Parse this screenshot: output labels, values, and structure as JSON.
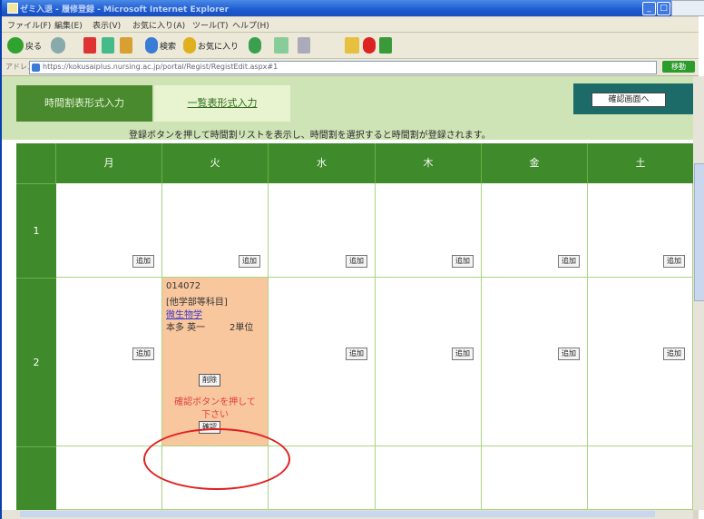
{
  "window": {
    "title": "ゼミ入退 - 履修登録 - Microsoft Internet Explorer",
    "controls": [
      "minimize",
      "maximize",
      "close"
    ]
  },
  "menu": {
    "items": [
      "ファイル(F)",
      "編集(E)",
      "表示(V)",
      "お気に入り(A)",
      "ツール(T)",
      "ヘルプ(H)"
    ]
  },
  "toolbar": {
    "back_label": "戻る",
    "search_label": "検索",
    "favorites_label": "お気に入り"
  },
  "address": {
    "label": "アドレス(D)",
    "url": "https://kokusaiplus.nursing.ac.jp/portal/Regist/RegistEdit.aspx#1",
    "go_label": "移動"
  },
  "page": {
    "tabs": [
      "時間割表形式入力",
      "一覧表形式入力"
    ],
    "confirm_button": "確認画面へ",
    "instruction": "登録ボタンを押して時間割リストを表示し、時間割を選択すると時間割が登録されます。",
    "days": [
      "月",
      "火",
      "水",
      "木",
      "金",
      "土"
    ],
    "periods": [
      "1",
      "2"
    ],
    "add_label": "追加",
    "selected_course": {
      "code": "014072",
      "category": "[他学部等科目]",
      "title": "微生物学",
      "teacher": "本多 英一",
      "credits": "2単位",
      "delete_label": "削除",
      "warning_line1": "確認ボタンを押して",
      "warning_line2": "下さい",
      "confirm_label": "確認"
    }
  },
  "colors": {
    "header_green": "#3f8a2a",
    "grid_green": "#c9e6a6",
    "selected_cell": "#f9c79e",
    "warning_red": "#e04040",
    "highlight_oval": "#e02020"
  }
}
